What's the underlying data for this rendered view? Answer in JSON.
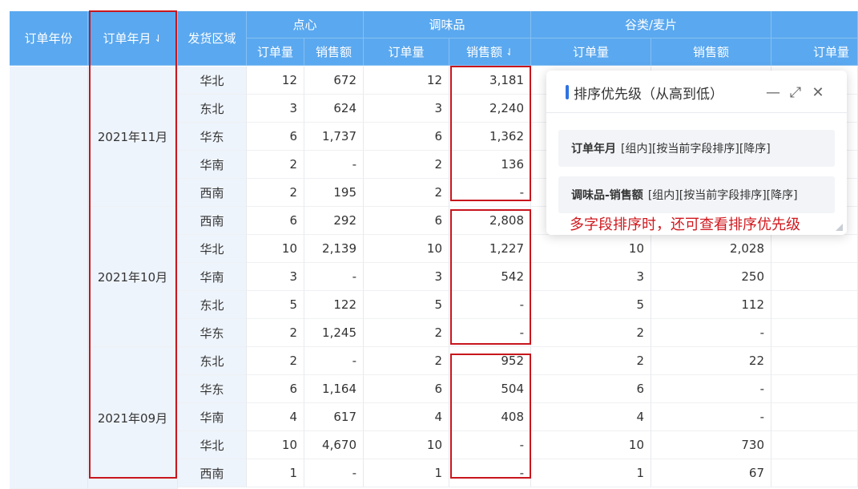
{
  "headers": {
    "order_year": "订单年份",
    "order_month": "订单年月",
    "region": "发货区域",
    "groups": [
      "点心",
      "调味品",
      "谷类/麦片"
    ],
    "sub": [
      "订单量",
      "销售额",
      "订单量",
      "销售额",
      "订单量",
      "销售额",
      "订单量"
    ],
    "sort_glyph": "⇃"
  },
  "months": [
    {
      "label": "2021年11月",
      "rows": [
        {
          "region": "华北",
          "d_q": "12",
          "d_s": "672",
          "t_q": "12",
          "t_s": "3,181",
          "g_q": "",
          "g_s": ""
        },
        {
          "region": "东北",
          "d_q": "3",
          "d_s": "624",
          "t_q": "3",
          "t_s": "2,240",
          "g_q": "",
          "g_s": ""
        },
        {
          "region": "华东",
          "d_q": "6",
          "d_s": "1,737",
          "t_q": "6",
          "t_s": "1,362",
          "g_q": "",
          "g_s": ""
        },
        {
          "region": "华南",
          "d_q": "2",
          "d_s": "-",
          "t_q": "2",
          "t_s": "136",
          "g_q": "",
          "g_s": ""
        },
        {
          "region": "西南",
          "d_q": "2",
          "d_s": "195",
          "t_q": "2",
          "t_s": "-",
          "g_q": "",
          "g_s": ""
        }
      ]
    },
    {
      "label": "2021年10月",
      "rows": [
        {
          "region": "西南",
          "d_q": "6",
          "d_s": "292",
          "t_q": "6",
          "t_s": "2,808",
          "g_q": "",
          "g_s": ""
        },
        {
          "region": "华北",
          "d_q": "10",
          "d_s": "2,139",
          "t_q": "10",
          "t_s": "1,227",
          "g_q": "10",
          "g_s": "2,028"
        },
        {
          "region": "华南",
          "d_q": "3",
          "d_s": "-",
          "t_q": "3",
          "t_s": "542",
          "g_q": "3",
          "g_s": "250"
        },
        {
          "region": "东北",
          "d_q": "5",
          "d_s": "122",
          "t_q": "5",
          "t_s": "-",
          "g_q": "5",
          "g_s": "112"
        },
        {
          "region": "华东",
          "d_q": "2",
          "d_s": "1,245",
          "t_q": "2",
          "t_s": "-",
          "g_q": "2",
          "g_s": "-"
        }
      ]
    },
    {
      "label": "2021年09月",
      "rows": [
        {
          "region": "东北",
          "d_q": "2",
          "d_s": "-",
          "t_q": "2",
          "t_s": "952",
          "g_q": "2",
          "g_s": "22"
        },
        {
          "region": "华东",
          "d_q": "6",
          "d_s": "1,164",
          "t_q": "6",
          "t_s": "504",
          "g_q": "6",
          "g_s": "-"
        },
        {
          "region": "华南",
          "d_q": "4",
          "d_s": "617",
          "t_q": "4",
          "t_s": "408",
          "g_q": "4",
          "g_s": "-"
        },
        {
          "region": "华北",
          "d_q": "10",
          "d_s": "4,670",
          "t_q": "10",
          "t_s": "-",
          "g_q": "10",
          "g_s": "730"
        },
        {
          "region": "西南",
          "d_q": "1",
          "d_s": "-",
          "t_q": "1",
          "t_s": "-",
          "g_q": "1",
          "g_s": "67"
        }
      ]
    }
  ],
  "panel": {
    "title": "排序优先级（从高到低）",
    "items": [
      {
        "field": "订单年月",
        "detail": "[组内][按当前字段排序][降序]"
      },
      {
        "field": "调味品-销售额",
        "detail": "[组内][按当前字段排序][降序]"
      }
    ],
    "minimize": "—",
    "expand": "⤢",
    "close": "✕"
  },
  "annotation": "多字段排序时，还可查看排序优先级",
  "colors": {
    "header": "#5aa8ef",
    "highlight": "#c8161d",
    "accent": "#2f73e0"
  }
}
